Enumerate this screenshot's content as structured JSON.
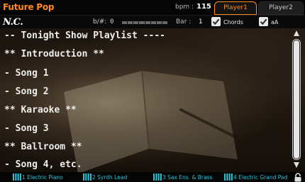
{
  "header": {
    "song_title": "Future Pop",
    "bpm_label": "bpm :",
    "bpm_value": "115",
    "tabs": [
      {
        "label": "Player1",
        "active": true
      },
      {
        "label": "Player2",
        "active": false
      }
    ]
  },
  "status": {
    "chord": "N.C.",
    "transpose_label": "b/#:",
    "transpose_value": "0",
    "bar_label": "Bar :",
    "bar_value": "1",
    "chords_checkbox": {
      "label": "Chords",
      "checked": true
    },
    "aa_checkbox": {
      "label": "aA",
      "checked": true
    }
  },
  "lyrics": {
    "lines": [
      "-- Tonight Show Playlist ----",
      "** Introduction **",
      "- Song 1",
      "- Song 2",
      "** Karaoke **",
      "- Song 3",
      "** Ballroom **",
      "- Song 4, etc."
    ]
  },
  "parts": [
    {
      "label": "1 Electric Piano"
    },
    {
      "label": "2  Synth Lead"
    },
    {
      "label": "3  Sax Ens. & Brass"
    },
    {
      "label": "4  Electric Grand Pad"
    }
  ],
  "colors": {
    "accent": "#ff8a1e",
    "part_label": "#26c6da",
    "lyric_text": "#eeeeee"
  },
  "icons": {
    "checkbox": "check-icon",
    "scroll_up": "triangle-up-icon",
    "scroll_down": "triangle-down-icon",
    "part": "keyboard-icon",
    "lock": "lock-icon"
  }
}
